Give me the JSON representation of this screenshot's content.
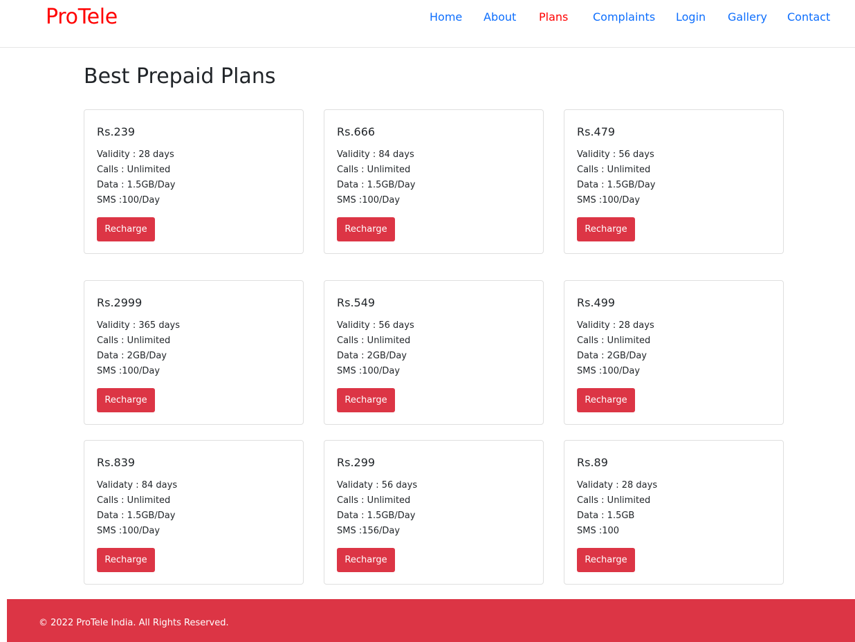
{
  "brand": "ProTele",
  "nav": {
    "home": "Home",
    "about": "About",
    "plans": "Plans",
    "complaints": "Complaints",
    "login": "Login",
    "gallery": "Gallery",
    "contact": "Contact"
  },
  "page_title": "Best Prepaid Plans",
  "plans": [
    {
      "price": "Rs.239",
      "validity": "Validity : 28 days",
      "calls": "Calls : Unlimited",
      "data": "Data : 1.5GB/Day",
      "sms": "SMS :100/Day",
      "button": "Recharge"
    },
    {
      "price": "Rs.666",
      "validity": "Validity : 84 days",
      "calls": "Calls : Unlimited",
      "data": "Data : 1.5GB/Day",
      "sms": "SMS :100/Day",
      "button": "Recharge"
    },
    {
      "price": "Rs.479",
      "validity": "Validity : 56 days",
      "calls": "Calls : Unlimited",
      "data": "Data : 1.5GB/Day",
      "sms": "SMS :100/Day",
      "button": "Recharge"
    },
    {
      "price": "Rs.2999",
      "validity": "Validity : 365 days",
      "calls": "Calls : Unlimited",
      "data": "Data : 2GB/Day",
      "sms": "SMS :100/Day",
      "button": "Recharge"
    },
    {
      "price": "Rs.549",
      "validity": "Validity : 56 days",
      "calls": "Calls : Unlimited",
      "data": "Data : 2GB/Day",
      "sms": "SMS :100/Day",
      "button": "Recharge"
    },
    {
      "price": "Rs.499",
      "validity": "Validity : 28 days",
      "calls": "Calls : Unlimited",
      "data": "Data : 2GB/Day",
      "sms": "SMS :100/Day",
      "button": "Recharge"
    },
    {
      "price": "Rs.839",
      "validity": "Validaty : 84 days",
      "calls": "Calls : Unlimited",
      "data": "Data : 1.5GB/Day",
      "sms": "SMS :100/Day",
      "button": "Recharge"
    },
    {
      "price": "Rs.299",
      "validity": "Validaty : 56 days",
      "calls": "Calls : Unlimited",
      "data": "Data : 1.5GB/Day",
      "sms": "SMS :156/Day",
      "button": "Recharge"
    },
    {
      "price": "Rs.89",
      "validity": "Validaty : 28 days",
      "calls": "Calls : Unlimited",
      "data": "Data : 1.5GB",
      "sms": "SMS :100",
      "button": "Recharge"
    }
  ],
  "footer": {
    "text": "© 2022 ProTele India. All Rights Reserved."
  },
  "colors": {
    "brand": "#ff0000",
    "nav_link": "#0d6efd",
    "nav_active": "#ff0000",
    "button": "#dc3545",
    "footer": "#dc3545"
  }
}
